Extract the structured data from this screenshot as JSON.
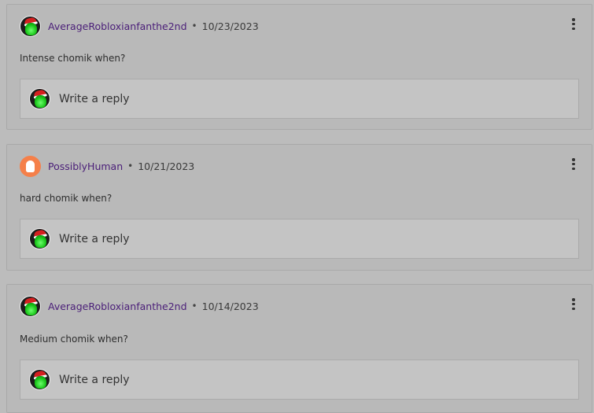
{
  "comments": [
    {
      "username": "AverageRobloxianfanthe2nd",
      "date": "10/23/2023",
      "avatar": "frog-santa-hat-avatar",
      "text": "Intense chomik when?",
      "reply_placeholder": "Write a reply"
    },
    {
      "username": "PossiblyHuman",
      "date": "10/21/2023",
      "avatar": "ghost-avatar",
      "text": "hard chomik when?",
      "reply_placeholder": "Write a reply"
    },
    {
      "username": "AverageRobloxianfanthe2nd",
      "date": "10/14/2023",
      "avatar": "frog-santa-hat-avatar",
      "text": "Medium chomik when?",
      "reply_placeholder": "Write a reply"
    }
  ],
  "separator": "•",
  "colors": {
    "background": "#bcbcbc",
    "card": "#b9b9b9",
    "reply_box": "#c4c4c4",
    "username": "#4a1e78",
    "ghost_avatar": "#f5804a"
  }
}
